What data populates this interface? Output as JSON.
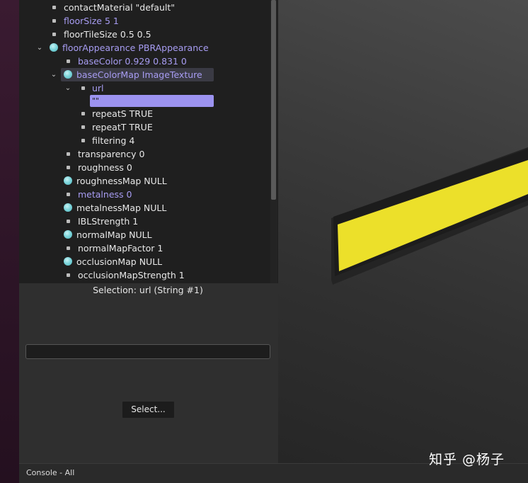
{
  "tree": {
    "rows": [
      {
        "label": "contactMaterial \"default\"",
        "color": "white"
      },
      {
        "label": "floorSize 5 1",
        "color": "purple"
      },
      {
        "label": "floorTileSize 0.5 0.5",
        "color": "white"
      },
      {
        "label": "floorAppearance PBRAppearance",
        "color": "purple",
        "expand_arrow": "⌄"
      },
      {
        "label": "baseColor 0.929 0.831 0",
        "color": "purple"
      },
      {
        "label": "baseColorMap ImageTexture",
        "color": "purple",
        "expand_arrow": "⌄"
      },
      {
        "label": "url",
        "color": "purple",
        "expand_arrow": "⌄"
      },
      {
        "label": "repeatS TRUE",
        "color": "white"
      },
      {
        "label": "repeatT TRUE",
        "color": "white"
      },
      {
        "label": "filtering 4",
        "color": "white"
      },
      {
        "label": "transparency 0",
        "color": "white"
      },
      {
        "label": "roughness 0",
        "color": "white"
      },
      {
        "label": "roughnessMap NULL",
        "color": "white"
      },
      {
        "label": "metalness 0",
        "color": "purple"
      },
      {
        "label": "metalnessMap NULL",
        "color": "white"
      },
      {
        "label": "IBLStrength 1",
        "color": "white"
      },
      {
        "label": "normalMap NULL",
        "color": "white"
      },
      {
        "label": "normalMapFactor 1",
        "color": "white"
      },
      {
        "label": "occlusionMap NULL",
        "color": "white"
      },
      {
        "label": "occlusionMapStrength 1",
        "color": "white"
      }
    ],
    "url_value": "\"\""
  },
  "properties": {
    "selection_text": "Selection: url (String #1)",
    "value_field": "",
    "select_button": "Select..."
  },
  "viewport": {
    "bar_color": "#ece02a",
    "bar_border": "#1c1c1c"
  },
  "console": {
    "label": "Console - All"
  },
  "watermark": "知乎 @杨子"
}
